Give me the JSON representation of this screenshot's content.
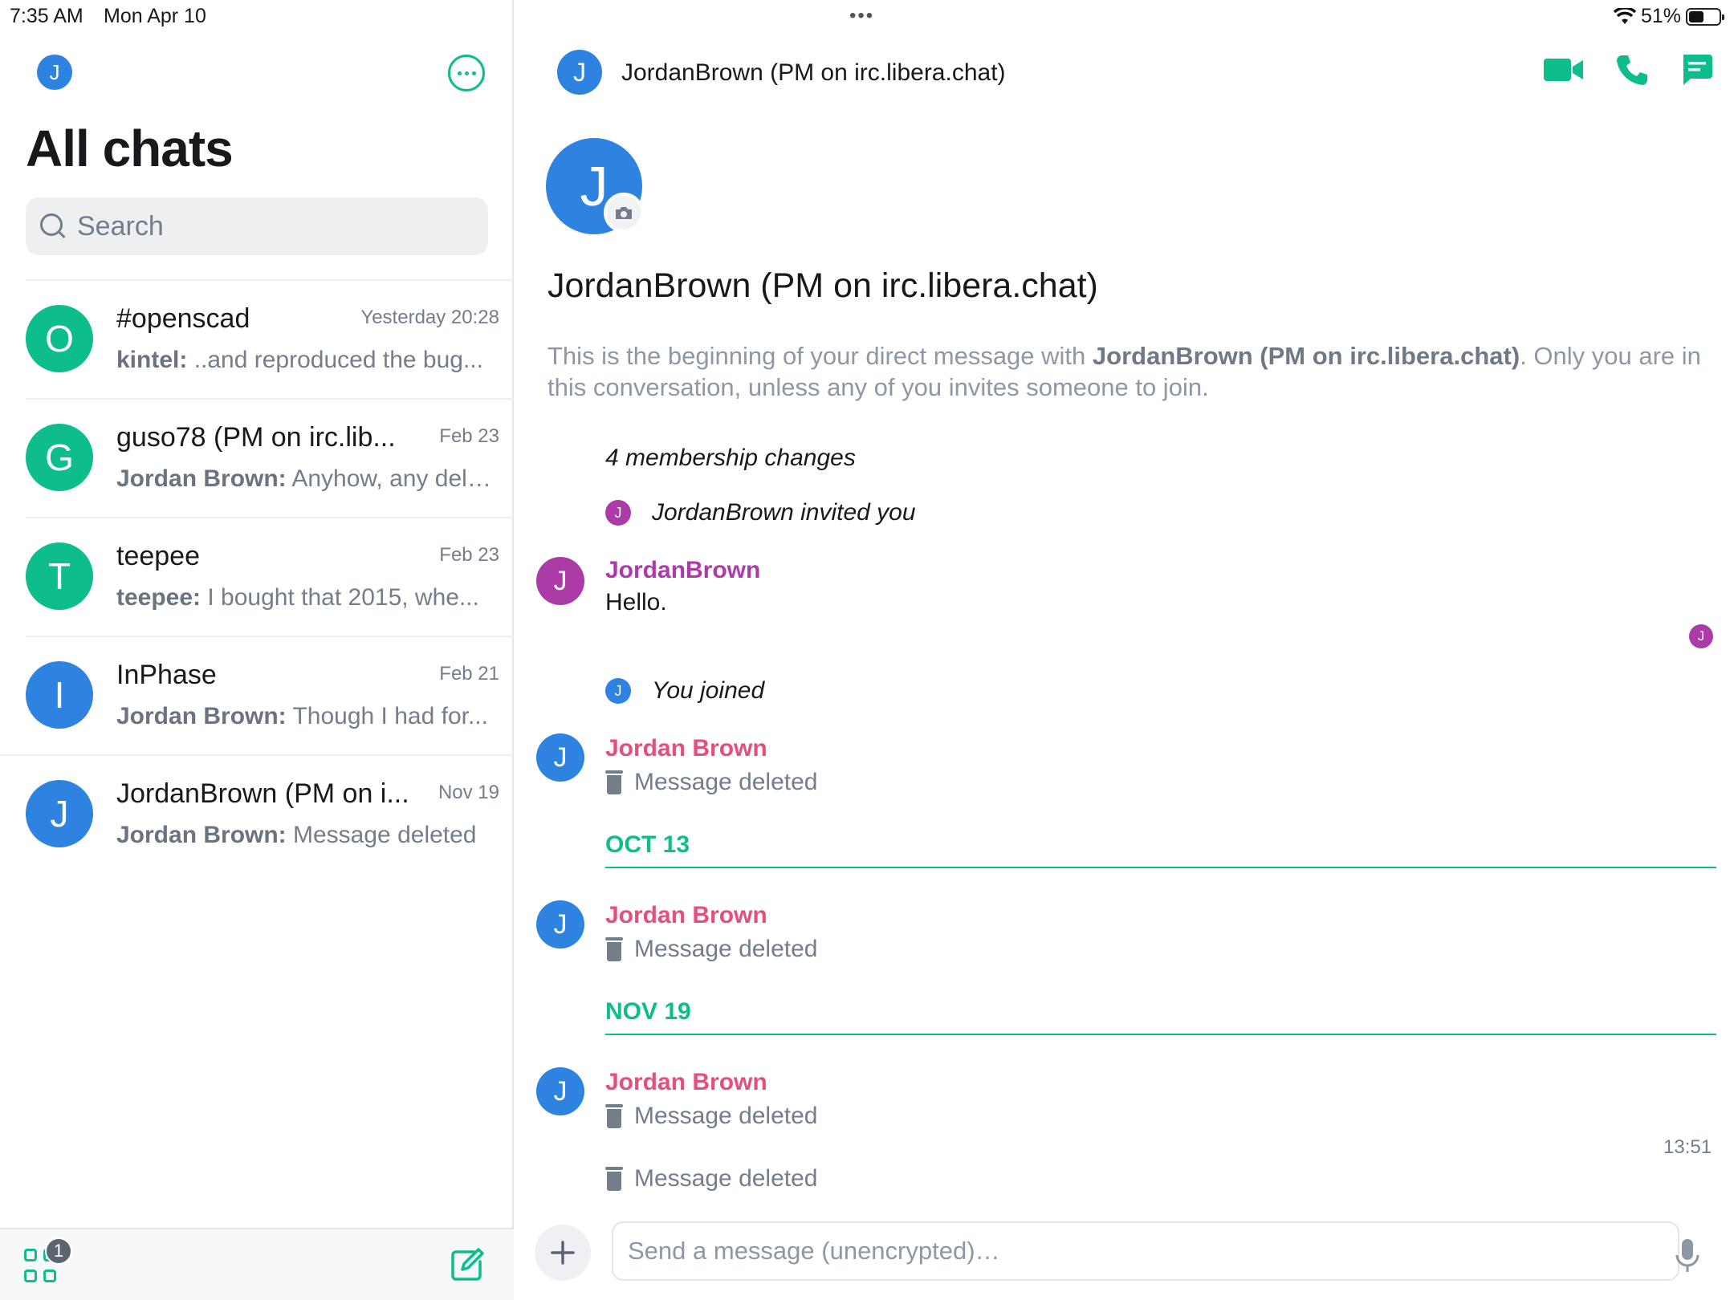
{
  "status_bar": {
    "time": "7:35 AM",
    "date": "Mon Apr 10",
    "battery": "51%",
    "battery_level": 0.51,
    "dots": "•••"
  },
  "sidebar": {
    "user_initial": "J",
    "title": "All chats",
    "search_placeholder": "Search",
    "chats": [
      {
        "initial": "O",
        "color": "#0dbd8b",
        "name": "#openscad",
        "time": "Yesterday 20:28",
        "sender": "kintel:",
        "preview": " ..and reproduced the bug..."
      },
      {
        "initial": "G",
        "color": "#0dbd8b",
        "name": "guso78 (PM on irc.lib...",
        "time": "Feb 23",
        "sender": "Jordan Brown:",
        "preview": " Anyhow, any dela..."
      },
      {
        "initial": "T",
        "color": "#0dbd8b",
        "name": "teepee",
        "time": "Feb 23",
        "sender": "teepee:",
        "preview": " I bought that 2015, whe..."
      },
      {
        "initial": "I",
        "color": "#2e83e0",
        "name": "InPhase",
        "time": "Feb 21",
        "sender": "Jordan Brown:",
        "preview": " Though I had for..."
      },
      {
        "initial": "J",
        "color": "#2e83e0",
        "name": "JordanBrown (PM on i...",
        "time": "Nov 19",
        "sender": "Jordan Brown:",
        "preview": "  Message deleted"
      }
    ],
    "badge_count": "1"
  },
  "room": {
    "initial": "J",
    "title": "JordanBrown (PM on irc.libera.chat)",
    "intro_pre": "This is the beginning of your direct message with ",
    "intro_name": "JordanBrown (PM on irc.libera.chat)",
    "intro_post": ". Only you are in this conversation, unless any of you invites someone to join.",
    "membership_summary": "4 membership changes",
    "invited_event": "JordanBrown invited you",
    "joined_event": "You joined",
    "msg1_sender": "JordanBrown",
    "msg1_body": "Hello.",
    "sender2": "Jordan Brown",
    "deleted_text": "Message deleted",
    "date_sep_1": "OCT 13",
    "date_sep_2": "NOV 19",
    "timestamp": "13:51",
    "composer_placeholder": "Send a message (unencrypted)…"
  },
  "colors": {
    "accent": "#0dbd8b",
    "blue": "#2e83e0",
    "purple": "#ac3ba8",
    "pink": "#e64f7a"
  }
}
